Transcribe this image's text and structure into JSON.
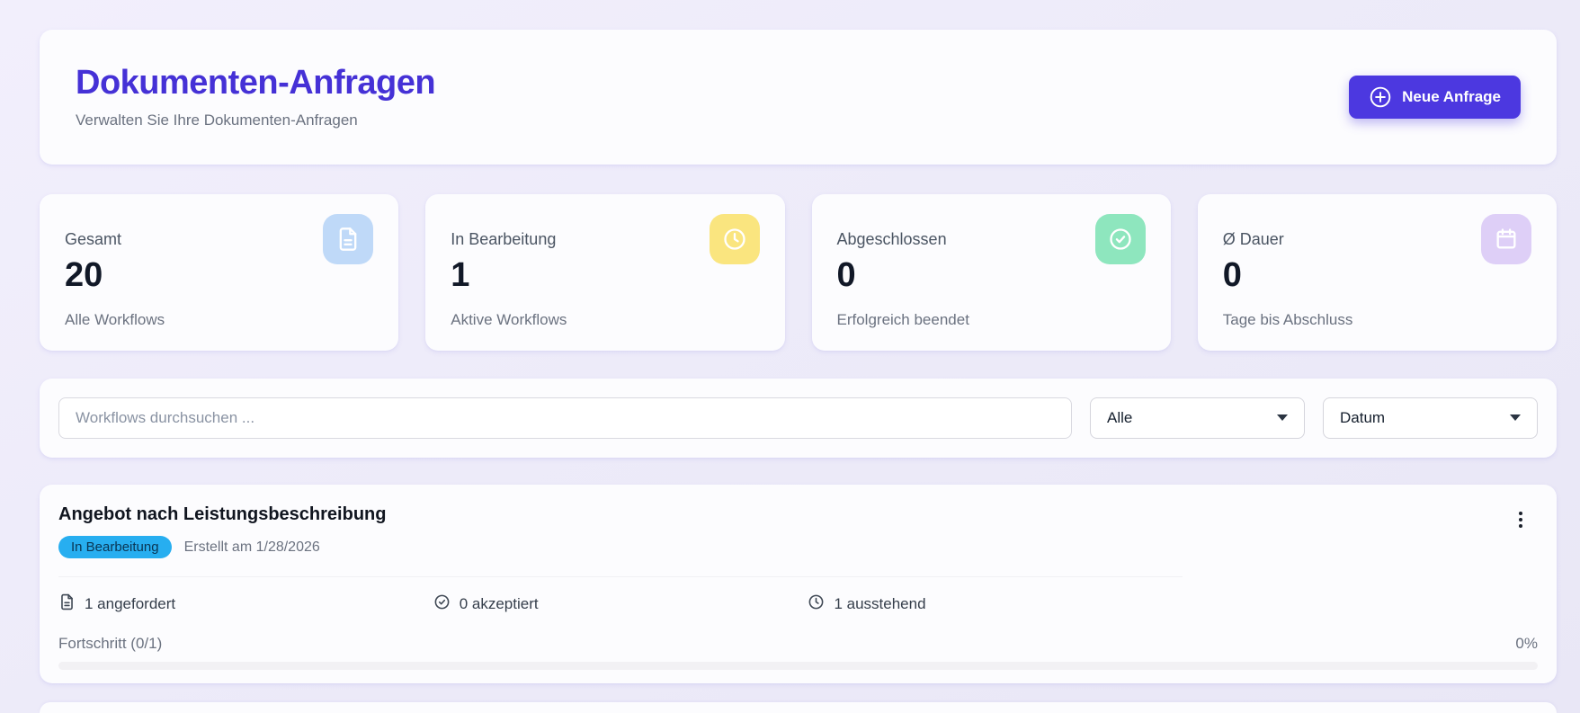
{
  "header": {
    "title": "Dokumenten-Anfragen",
    "subtitle": "Verwalten Sie Ihre Dokumenten-Anfragen",
    "new_request_label": "Neue Anfrage",
    "new_request_icon": "plus-circle-icon"
  },
  "stats": [
    {
      "label": "Gesamt",
      "value": "20",
      "sublabel": "Alle Workflows",
      "icon": "file-text-icon",
      "icon_bg": "#BFD9F8"
    },
    {
      "label": "In Bearbeitung",
      "value": "1",
      "sublabel": "Aktive Workflows",
      "icon": "clock-icon",
      "icon_bg": "#FAE57F"
    },
    {
      "label": "Abgeschlossen",
      "value": "0",
      "sublabel": "Erfolgreich beendet",
      "icon": "check-circle-icon",
      "icon_bg": "#8EE6BE"
    },
    {
      "label": "Ø Dauer",
      "value": "0",
      "sublabel": "Tage bis Abschluss",
      "icon": "calendar-icon",
      "icon_bg": "#DECFF7"
    }
  ],
  "filters": {
    "search_placeholder": "Workflows durchsuchen ...",
    "status_selected": "Alle",
    "date_selected": "Datum"
  },
  "workflow": {
    "title": "Angebot nach Leistungsbeschreibung",
    "status_badge": "In Bearbeitung",
    "created": "Erstellt am 1/28/2026",
    "stats": [
      {
        "icon": "file-text-icon",
        "label": "1 angefordert"
      },
      {
        "icon": "check-circle-icon",
        "label": "0 akzeptiert"
      },
      {
        "icon": "clock-icon",
        "label": "1 ausstehend"
      }
    ],
    "progress_label": "Fortschritt (0/1)",
    "progress_percent": "0%",
    "progress_width": "0%",
    "menu_icon": "kebab-menu-icon"
  },
  "colors": {
    "accent_purple": "#4C38E0",
    "title_purple": "#4531D6",
    "badge_cyan": "#27AEF0",
    "page_background": "#EDEBF9",
    "card_background": "#FCFCFE"
  }
}
